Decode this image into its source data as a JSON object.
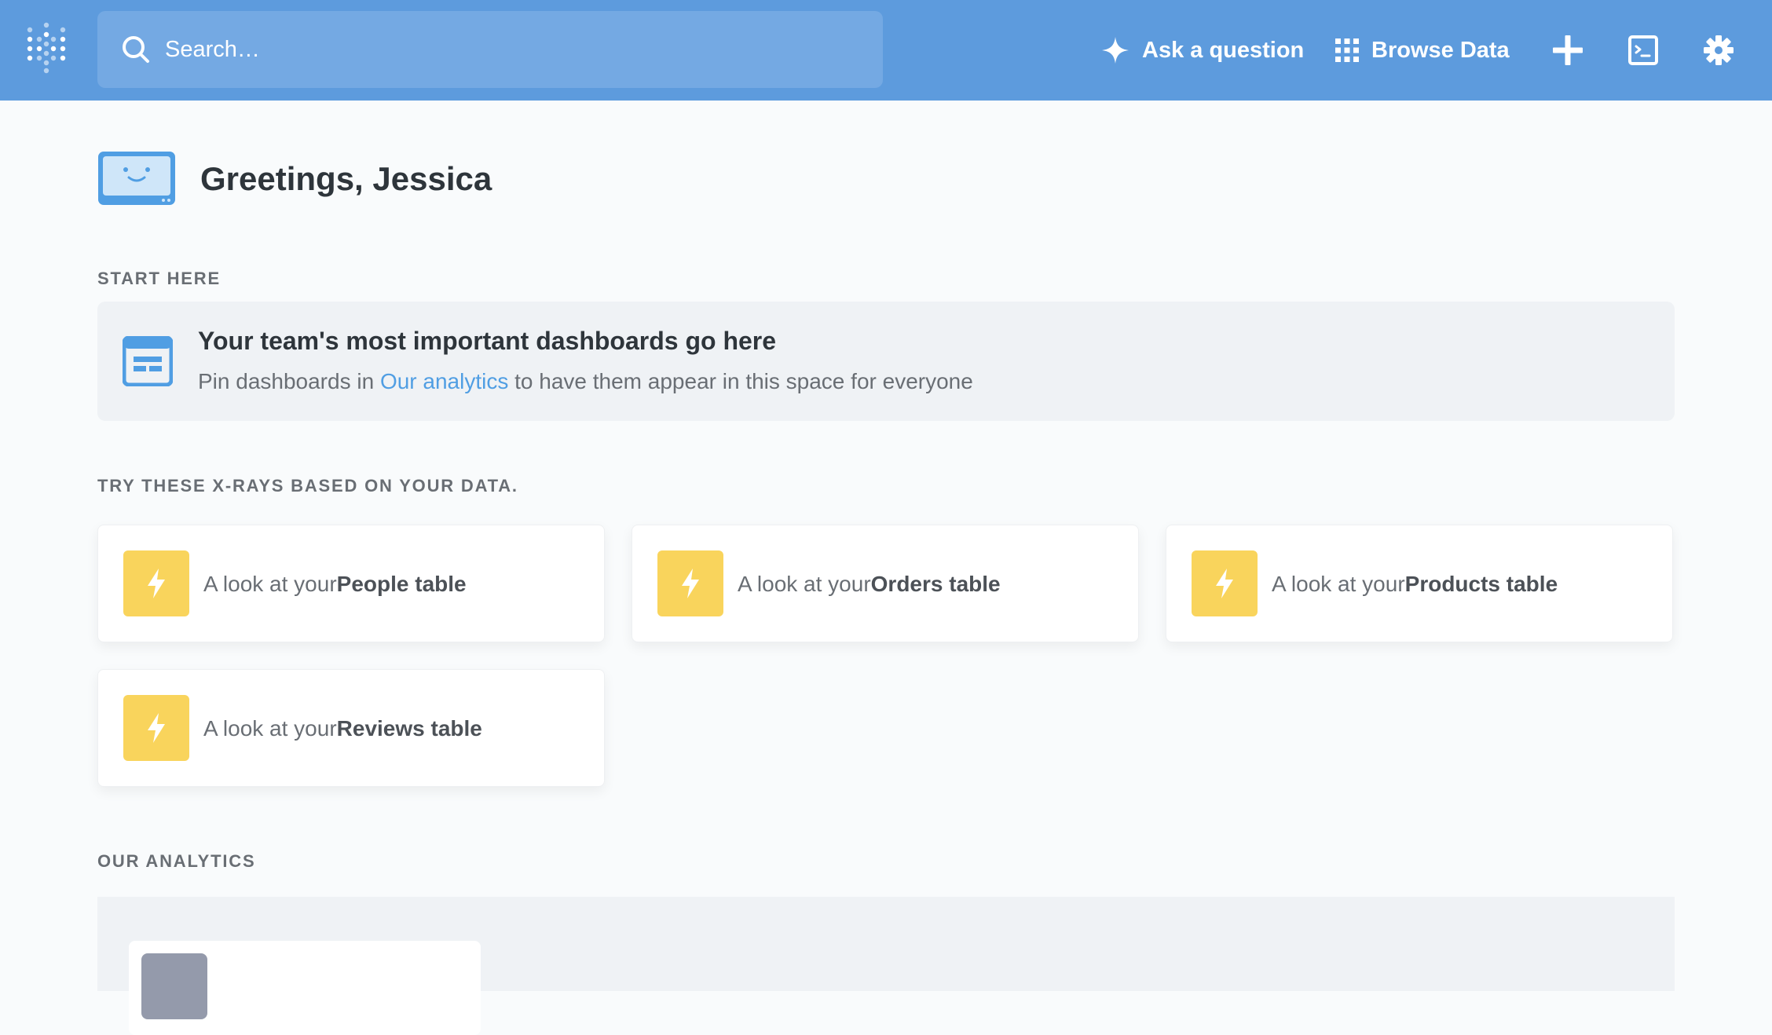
{
  "app": {
    "brand_color": "#5d9bdd",
    "accent_link_color": "#509ee3",
    "xray_icon_color": "#f9d45c"
  },
  "topnav": {
    "search_placeholder": "Search…",
    "ask_label": "Ask a question",
    "browse_label": "Browse Data",
    "icons": [
      "sparkle-icon",
      "grid-icon",
      "plus-icon",
      "terminal-icon",
      "gear-icon"
    ]
  },
  "greeting": {
    "text": "Greetings, Jessica"
  },
  "start_here": {
    "label": "START HERE",
    "title": "Your team's most important dashboards go here",
    "desc_prefix": "Pin dashboards in ",
    "desc_link": "Our analytics",
    "desc_suffix": " to have them appear in this space for everyone"
  },
  "xrays": {
    "label": "TRY THESE X-RAYS BASED ON YOUR DATA.",
    "items": [
      {
        "prefix": "A look at your ",
        "table": "People table"
      },
      {
        "prefix": "A look at your ",
        "table": "Orders table"
      },
      {
        "prefix": "A look at your ",
        "table": "Products table"
      },
      {
        "prefix": "A look at your ",
        "table": "Reviews table"
      }
    ]
  },
  "our_analytics": {
    "label": "OUR ANALYTICS"
  }
}
